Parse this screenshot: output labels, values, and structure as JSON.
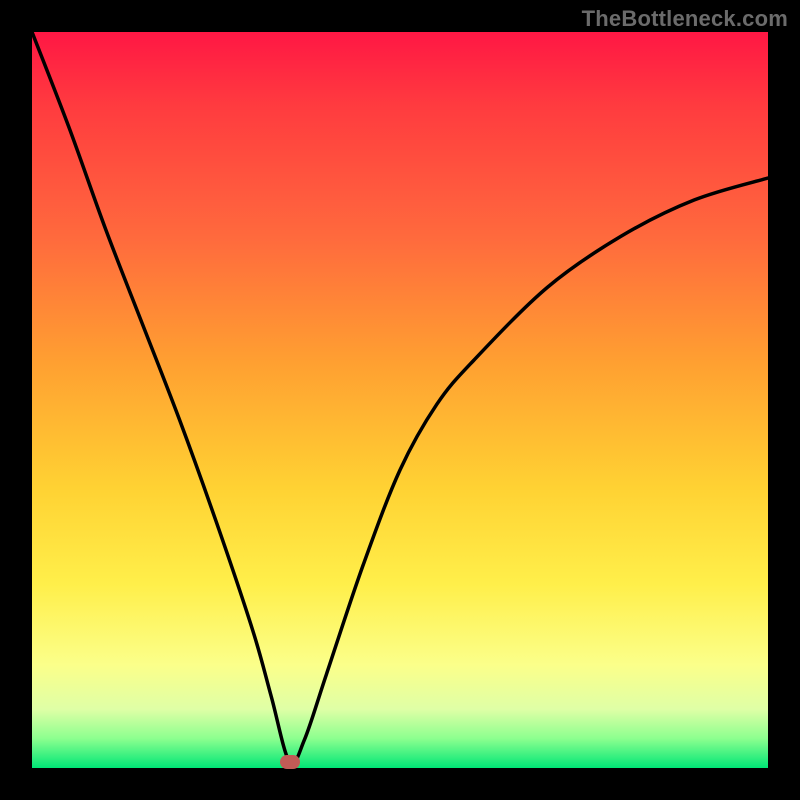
{
  "watermark": "TheBottleneck.com",
  "chart_data": {
    "type": "line",
    "title": "",
    "xlabel": "",
    "ylabel": "",
    "x": [
      0.0,
      0.05,
      0.1,
      0.15,
      0.2,
      0.25,
      0.3,
      0.325,
      0.35,
      0.37,
      0.4,
      0.45,
      0.5,
      0.55,
      0.6,
      0.7,
      0.8,
      0.9,
      1.0
    ],
    "values": [
      1.0,
      0.87,
      0.73,
      0.6,
      0.47,
      0.33,
      0.18,
      0.09,
      0.0,
      0.03,
      0.12,
      0.27,
      0.4,
      0.49,
      0.55,
      0.65,
      0.72,
      0.77,
      0.8
    ],
    "minimum_x": 0.35,
    "minimum_y": 0.0,
    "xlim": [
      0,
      1
    ],
    "ylim": [
      0,
      1
    ],
    "legend": [],
    "annotations": [],
    "background_gradient": [
      "#ff1744",
      "#ff6a3d",
      "#ffd233",
      "#fbff8a",
      "#00e676"
    ],
    "marker": {
      "x": 0.35,
      "y": 0.0,
      "color": "#c15b56"
    }
  }
}
